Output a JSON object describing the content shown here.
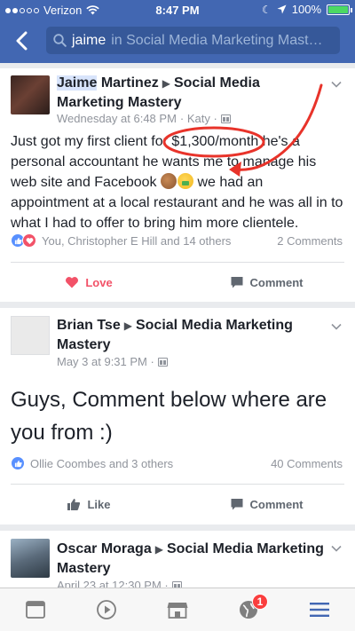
{
  "status_bar": {
    "carrier": "Verizon",
    "time": "8:47 PM",
    "battery_percent": "100%",
    "battery_level": 1.0,
    "battery_color": "#4cd964"
  },
  "nav": {
    "search_query": "jaime",
    "search_context": "in Social Media Marketing Mast…",
    "accent": "#4267b2"
  },
  "posts": [
    {
      "author_first": "Jaime",
      "author_last": "Martinez",
      "group": "Social Media Marketing Mastery",
      "time": "Wednesday at 6:48 PM",
      "location": "· Katy ·",
      "text_pre": "Just got my first client for",
      "text_amount": "$1,300/month",
      "text_post1": "he's a personal accountant he wants me to manage his web site and Facebook",
      "text_post2": "we had an appointment at a local restaurant and he was all in to what I had to offer to bring him more clientele.",
      "emoji_1": "flexed-biceps",
      "emoji_2": "money-mouth-face",
      "reactions": "You, Christopher E Hill and 14 others",
      "comments": "2 Comments",
      "action_left": "Love",
      "action_right": "Comment"
    },
    {
      "author": "Brian Tse",
      "group": "Social Media Marketing Mastery",
      "time": "May 3 at 9:31 PM ·",
      "text": "Guys, Comment below where are you from :)",
      "reactions": "Ollie Coombes and 3 others",
      "comments": "40 Comments",
      "action_left": "Like",
      "action_right": "Comment"
    },
    {
      "author": "Oscar Moraga",
      "group": "Social Media Marketing Mastery",
      "time": "April 23 at 12:30 PM ·"
    }
  ],
  "annotation_color": "#e8332a",
  "tabbar": {
    "items": [
      "news-feed-icon",
      "video-icon",
      "marketplace-icon",
      "notifications-globe-icon",
      "menu-icon"
    ],
    "notification_badge": "1",
    "active_color": "#4267b2"
  }
}
